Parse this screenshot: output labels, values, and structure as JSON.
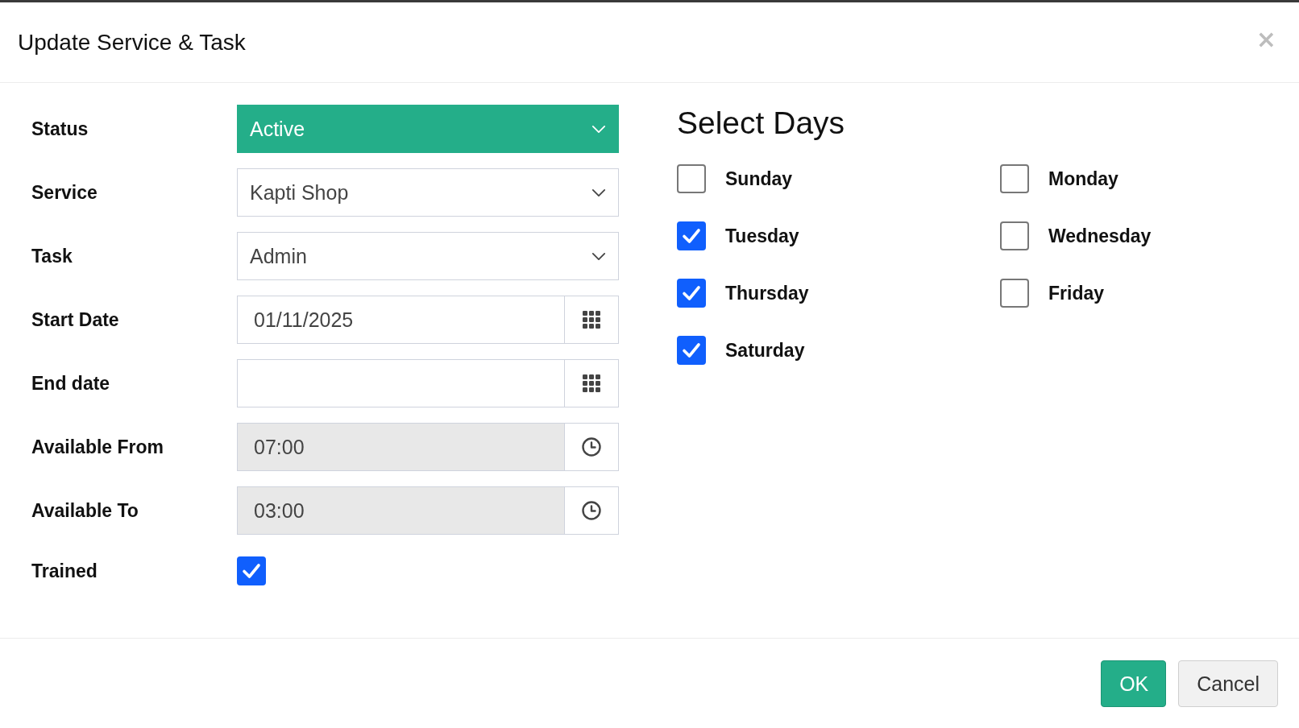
{
  "dialog": {
    "title": "Update Service & Task",
    "close": "×"
  },
  "form": {
    "fields": [
      {
        "label": "Status",
        "kind": "select",
        "value": "Active",
        "color": "#24ae89",
        "disabled": false
      },
      {
        "label": "Service",
        "kind": "select",
        "value": "Kapti Shop",
        "disabled": false
      },
      {
        "label": "Task",
        "kind": "select",
        "value": "Admin",
        "disabled": false
      },
      {
        "label": "Start Date",
        "kind": "date",
        "value": "01/11/2025",
        "disabled": false
      },
      {
        "label": "End date",
        "kind": "date",
        "disabled": false
      },
      {
        "label": "Available From",
        "kind": "time",
        "value": "07:00",
        "disabled": true
      },
      {
        "label": "Available To",
        "kind": "time",
        "value": "03:00",
        "disabled": true
      },
      {
        "label": "Trained",
        "kind": "checkbox",
        "checked": true
      }
    ]
  },
  "days": {
    "title": "Select Days",
    "items": [
      {
        "label": "Sunday",
        "checked": false
      },
      {
        "label": "Monday",
        "checked": false
      },
      {
        "label": "Tuesday",
        "checked": true
      },
      {
        "label": "Wednesday",
        "checked": false
      },
      {
        "label": "Thursday",
        "checked": true
      },
      {
        "label": "Friday",
        "checked": false
      },
      {
        "label": "Saturday",
        "checked": true
      }
    ]
  },
  "buttons": [
    {
      "label": "OK",
      "kind": "primary"
    },
    {
      "label": "Cancel",
      "kind": "secondary"
    }
  ]
}
